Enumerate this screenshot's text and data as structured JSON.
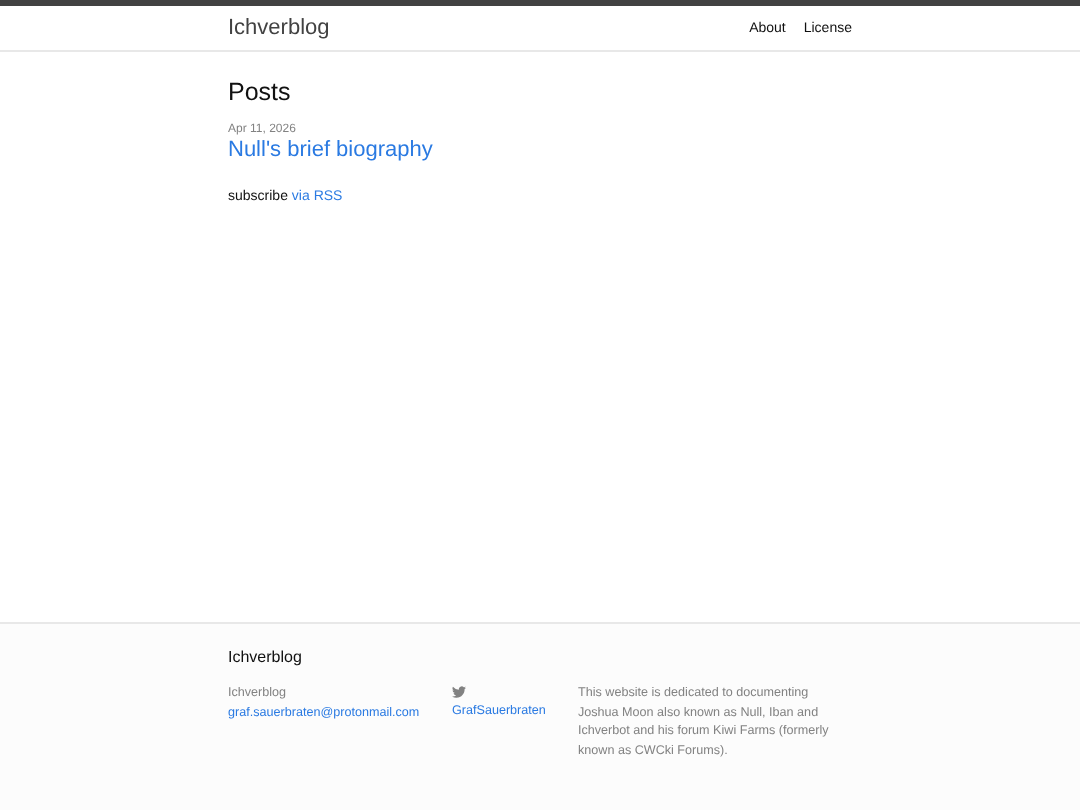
{
  "header": {
    "site_title": "Ichverblog",
    "nav": [
      "About",
      "License"
    ]
  },
  "main": {
    "heading": "Posts",
    "posts": [
      {
        "date": "Apr 11, 2026",
        "title": "Null's brief biography"
      }
    ],
    "subscribe": {
      "text": "subscribe",
      "link": "via RSS"
    }
  },
  "footer": {
    "title": "Ichverblog",
    "name": "Ichverblog",
    "email": "graf.sauerbraten@protonmail.com",
    "twitter": "GrafSauerbraten",
    "description": "This website is dedicated to documenting Joshua Moon also known as Null, Iban and Ichverbot and his forum Kiwi Farms (formerly known as CWCki Forums)."
  }
}
